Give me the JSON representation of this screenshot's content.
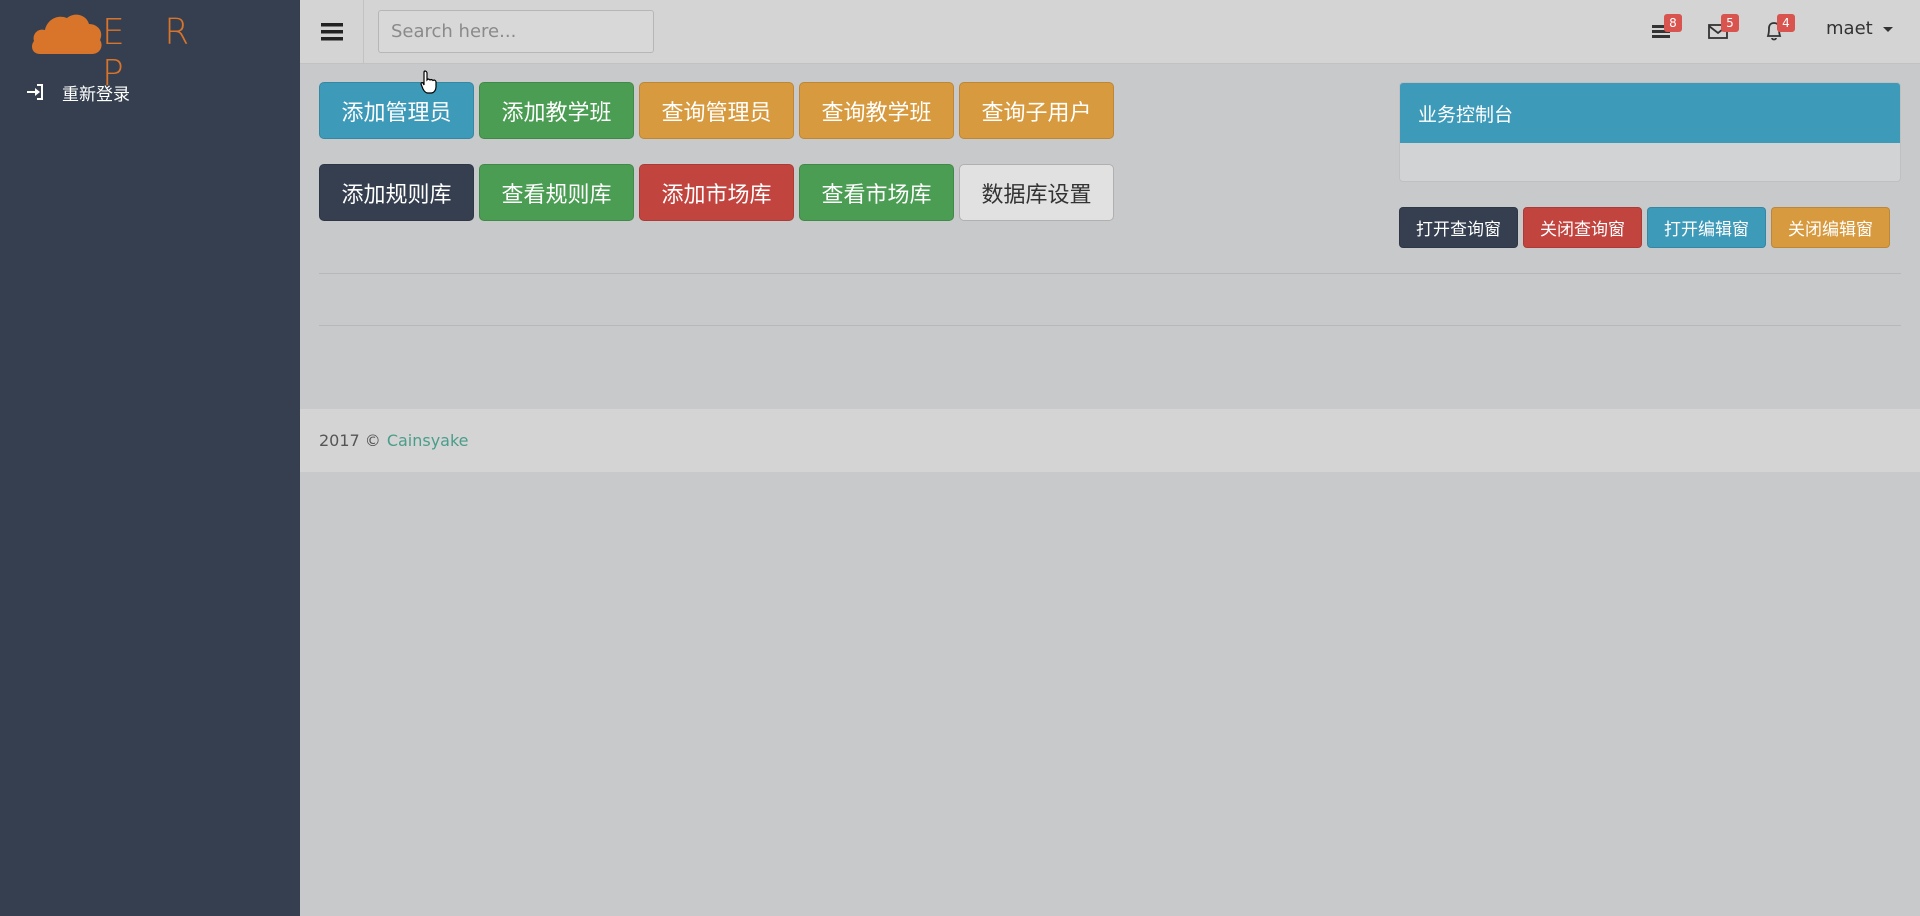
{
  "brand": {
    "logo_text": "E R P",
    "accent": "#d9742b"
  },
  "sidebar": {
    "background": "#353f4f",
    "items": [
      {
        "label": "重新登录",
        "icon": "sign-in-icon"
      }
    ]
  },
  "topbar": {
    "search_placeholder": "Search here...",
    "icons": [
      {
        "name": "tasks-icon",
        "badge": "8"
      },
      {
        "name": "envelope-icon",
        "badge": "5"
      },
      {
        "name": "bell-icon",
        "badge": "4"
      }
    ],
    "user": "maet"
  },
  "actions": {
    "row1": [
      "添加管理员",
      "添加教学班",
      "查询管理员",
      "查询教学班",
      "查询子用户"
    ],
    "row2": [
      "添加规则库",
      "查看规则库",
      "添加市场库",
      "查看市场库",
      "数据库设置"
    ]
  },
  "console": {
    "title": "业务控制台",
    "buttons": [
      "打开查询窗",
      "关闭查询窗",
      "打开编辑窗",
      "关闭编辑窗"
    ]
  },
  "footer": {
    "year_text": "2017 ©",
    "link": "Cainsyake"
  },
  "colors": {
    "blue": "#3d9ab9",
    "green": "#4a9d52",
    "orange": "#d89a3f",
    "dark": "#353f4f",
    "red": "#c2443f",
    "badge": "#d9534f"
  }
}
